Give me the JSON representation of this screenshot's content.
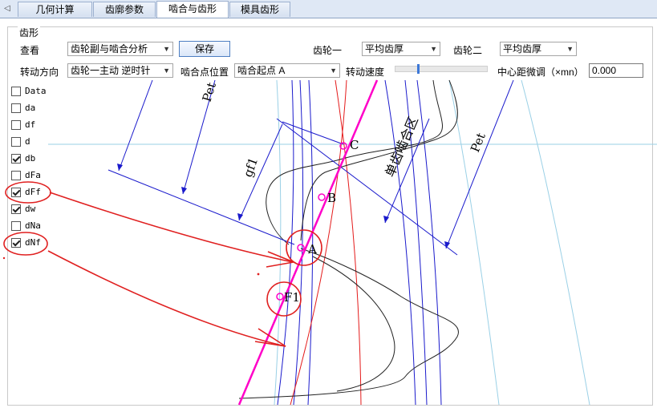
{
  "tabs": [
    {
      "label": "几何计算"
    },
    {
      "label": "齿廓参数"
    },
    {
      "label": "啮合与齿形"
    },
    {
      "label": "模具齿形"
    }
  ],
  "panel_title": "齿形",
  "view": {
    "label": "查看",
    "value": "齿轮副与啮合分析"
  },
  "save_label": "保存",
  "gear1": {
    "label": "齿轮一",
    "value": "平均齿厚"
  },
  "gear2": {
    "label": "齿轮二",
    "value": "平均齿厚"
  },
  "rotation": {
    "label": "转动方向",
    "value": "齿轮一主动 逆时针"
  },
  "mesh_point": {
    "label": "啮合点位置",
    "value": "啮合起点 A"
  },
  "speed_label": "转动速度",
  "speed_level": 0.25,
  "center_adjust": {
    "label": "中心距微调（×mn）",
    "value": "0.000"
  },
  "checkboxes": [
    {
      "label": "Data",
      "checked": false
    },
    {
      "label": "da",
      "checked": false
    },
    {
      "label": "df",
      "checked": false
    },
    {
      "label": "d",
      "checked": false
    },
    {
      "label": "db",
      "checked": true
    },
    {
      "label": "dFa",
      "checked": false
    },
    {
      "label": "dFf",
      "checked": true
    },
    {
      "label": "dw",
      "checked": true
    },
    {
      "label": "dNa",
      "checked": false
    },
    {
      "label": "dNf",
      "checked": true
    }
  ],
  "drawing": {
    "labels": {
      "pet_left": "Pet",
      "pet_right": "Pet",
      "gf1": "gf1",
      "single_zone": "单齿啮合区",
      "point_c": "C",
      "point_b": "B",
      "point_a": "A",
      "point_f1": "F1"
    },
    "colors": {
      "base_lines": "#1a1acc",
      "action_line": "#ff00c8",
      "pitch_red": "#e41b1b",
      "profile": "#222222",
      "light_circle": "#9ad0e6",
      "annotation_red": "#e02020"
    }
  }
}
